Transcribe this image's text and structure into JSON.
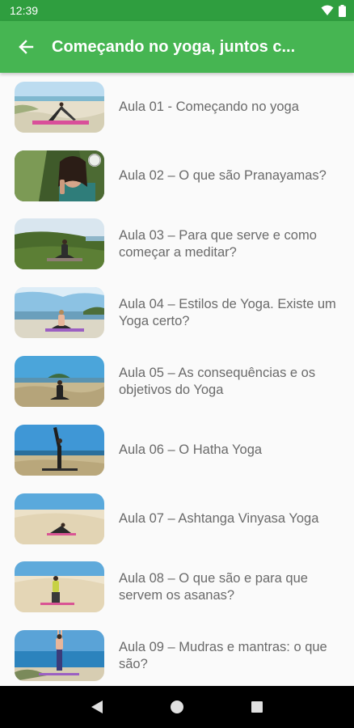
{
  "status_bar": {
    "time": "12:39",
    "icons": [
      "wifi-icon",
      "battery-icon"
    ]
  },
  "app_bar": {
    "back_icon": "arrow-left-icon",
    "title": "Começando no yoga, juntos c..."
  },
  "lessons": [
    {
      "title": "Aula 01 - Começando no yoga",
      "thumbnail": "woman-stretching-on-beach"
    },
    {
      "title": "Aula 02 – O que são Pranayamas?",
      "thumbnail": "woman-breathing-close-up"
    },
    {
      "title": "Aula 03 – Para que serve e como começar a meditar?",
      "thumbnail": "woman-meditating-on-hill"
    },
    {
      "title": "Aula 04 – Estilos de Yoga. Existe um Yoga certo?",
      "thumbnail": "woman-seated-on-beach"
    },
    {
      "title": "Aula 05 –  As consequências e os objetivos do Yoga",
      "thumbnail": "woman-seated-on-dune"
    },
    {
      "title": "Aula 06 – O Hatha Yoga",
      "thumbnail": "woman-standing-leg-raised"
    },
    {
      "title": "Aula 07 – Ashtanga Vinyasa Yoga",
      "thumbnail": "woman-on-sand-dune"
    },
    {
      "title": "Aula 08 – O que são e para que servem os asanas?",
      "thumbnail": "woman-standing-pose-dune"
    },
    {
      "title": "Aula 09 – Mudras e mantras: o que são?",
      "thumbnail": "woman-arms-raised-sea"
    }
  ],
  "nav_bar": {
    "icons": [
      "back-triangle-icon",
      "home-circle-icon",
      "recents-square-icon"
    ]
  },
  "colors": {
    "app_bar": "#46b552",
    "status_bar": "#2f9e3f",
    "text": "#6a6a6a"
  }
}
